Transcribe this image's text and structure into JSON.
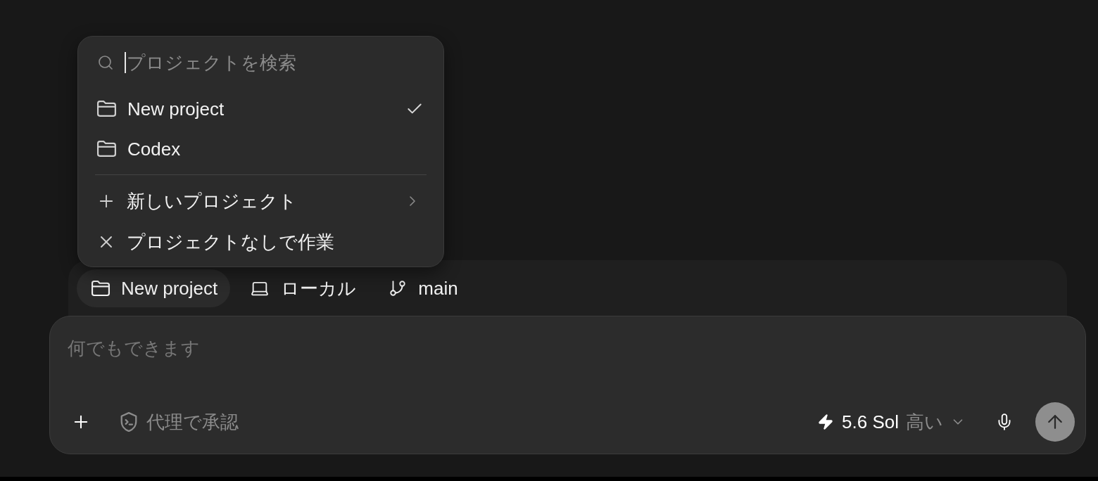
{
  "project_menu": {
    "search": {
      "placeholder": "プロジェクトを検索"
    },
    "projects": [
      {
        "name": "New project",
        "selected": true
      },
      {
        "name": "Codex",
        "selected": false
      }
    ],
    "actions": [
      {
        "kind": "create",
        "label": "新しいプロジェクト"
      },
      {
        "kind": "no_project",
        "label": "プロジェクトなしで作業"
      }
    ]
  },
  "context_bar": {
    "items": [
      {
        "kind": "project",
        "label": "New project",
        "expanded": true
      },
      {
        "kind": "environment",
        "label": "ローカル",
        "expanded": false
      },
      {
        "kind": "branch",
        "label": "main",
        "expanded": false
      }
    ]
  },
  "composer": {
    "placeholder": "何でもできます",
    "approval": "代理で承認",
    "model": {
      "name": "5.6 Sol",
      "effort": "高い"
    }
  }
}
